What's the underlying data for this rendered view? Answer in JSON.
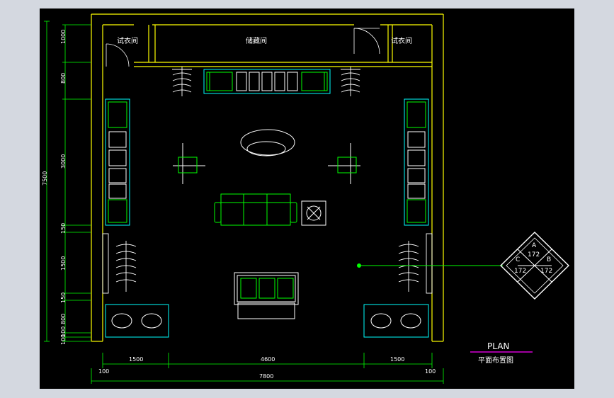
{
  "colors": {
    "background": "#000000",
    "wall": "#ffff00",
    "furniture": "#00ff00",
    "fixture": "#00ffff",
    "annotation": "#ffffff",
    "dimension": "#00ff00",
    "title_underline": "#ff00ff"
  },
  "rooms": {
    "fitting_left": "试衣间",
    "storage": "储藏间",
    "fitting_right": "试衣间"
  },
  "vertical_dims": [
    "1000",
    "800",
    "3000",
    "150",
    "1500",
    "150",
    "800",
    "100",
    "100"
  ],
  "vertical_total": "7500",
  "horizontal_dims": [
    "1500",
    "4600",
    "1500"
  ],
  "horizontal_edges": [
    "100",
    "100"
  ],
  "horizontal_total": "7800",
  "elevation_symbol": {
    "top": "A",
    "left": "C",
    "right": "B",
    "center": "172",
    "bottom_left": "172",
    "bottom_right": "172"
  },
  "title": {
    "english": "PLAN",
    "chinese": "平面布置图"
  }
}
